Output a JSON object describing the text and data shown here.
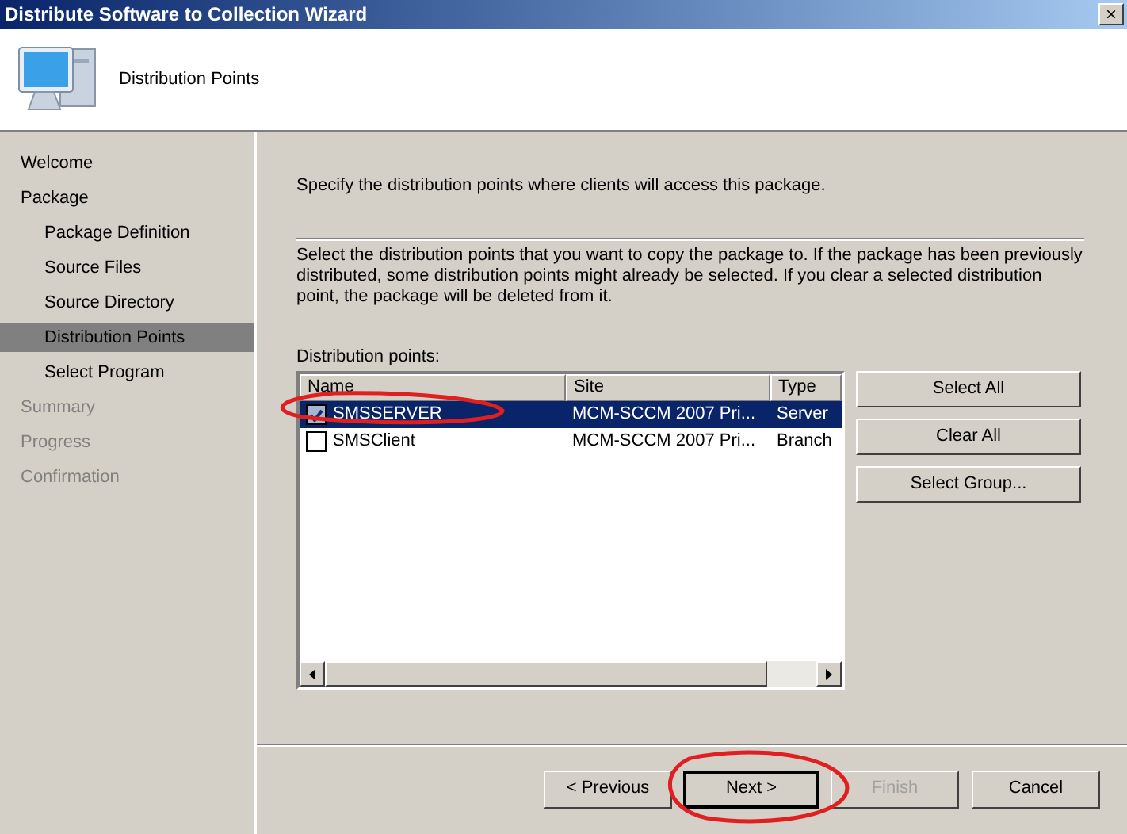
{
  "window": {
    "title": "Distribute Software to Collection Wizard",
    "close": "×"
  },
  "header": {
    "title": "Distribution Points"
  },
  "sidebar": {
    "items": [
      {
        "label": "Welcome",
        "selected": false,
        "disabled": false
      },
      {
        "label": "Package",
        "selected": false,
        "disabled": false,
        "children": [
          {
            "label": "Package Definition",
            "selected": false,
            "disabled": false
          },
          {
            "label": "Source Files",
            "selected": false,
            "disabled": false
          },
          {
            "label": "Source Directory",
            "selected": false,
            "disabled": false
          },
          {
            "label": "Distribution Points",
            "selected": true,
            "disabled": false
          },
          {
            "label": "Select Program",
            "selected": false,
            "disabled": false
          }
        ]
      },
      {
        "label": "Summary",
        "selected": false,
        "disabled": true
      },
      {
        "label": "Progress",
        "selected": false,
        "disabled": true
      },
      {
        "label": "Confirmation",
        "selected": false,
        "disabled": true
      }
    ]
  },
  "intro": "Specify the distribution points where clients will access this package.",
  "description": "Select the distribution points that you want to copy the package to. If the package has been previously distributed, some distribution points might already be selected. If you clear a selected distribution point, the package will be deleted from it.",
  "list_label": "Distribution points:",
  "table": {
    "columns": [
      "Name",
      "Site",
      "Type"
    ],
    "rows": [
      {
        "cells": [
          "SMSSERVER",
          "MCM-SCCM 2007 Pri...",
          "Server"
        ],
        "checked": true,
        "selected": true
      },
      {
        "cells": [
          "SMSClient",
          "MCM-SCCM 2007 Pri...",
          "Branch"
        ],
        "checked": false,
        "selected": false
      }
    ]
  },
  "side_buttons": [
    "Select All",
    "Clear All",
    "Select Group..."
  ],
  "footer_buttons": [
    {
      "label": "< Previous",
      "disabled": false,
      "default": false
    },
    {
      "label": "Next >",
      "disabled": false,
      "default": true
    },
    {
      "label": "Finish",
      "disabled": true,
      "default": false
    },
    {
      "label": "Cancel",
      "disabled": false,
      "default": false
    }
  ]
}
